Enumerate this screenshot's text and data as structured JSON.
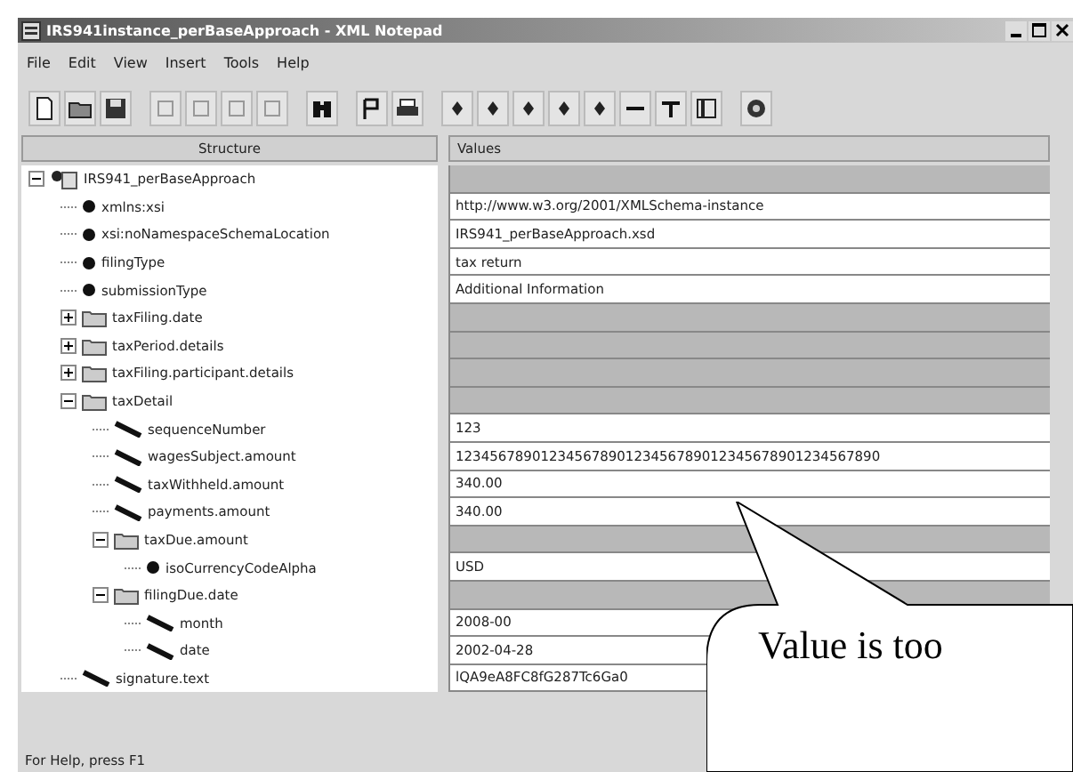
{
  "window": {
    "title": "IRS941instance_perBaseApproach - XML Notepad"
  },
  "menu": [
    "File",
    "Edit",
    "View",
    "Insert",
    "Tools",
    "Help"
  ],
  "columns": [
    "Structure",
    "Values"
  ],
  "tree": [
    {
      "kind": "root",
      "name": "IRS941_perBaseApproach",
      "expanded": true,
      "children": [
        {
          "kind": "attribute",
          "name": "xmlns:xsi",
          "value": "http://www.w3.org/2001/XMLSchema-instance"
        },
        {
          "kind": "attribute",
          "name": "xsi:noNamespaceSchemaLocation",
          "value": "IRS941_perBaseApproach.xsd"
        },
        {
          "kind": "attribute",
          "name": "filingType",
          "value": "tax return"
        },
        {
          "kind": "attribute",
          "name": "submissionType",
          "value": "Additional Information"
        },
        {
          "kind": "folder",
          "name": "taxFiling.date",
          "expanded": false
        },
        {
          "kind": "folder",
          "name": "taxPeriod.details",
          "expanded": false
        },
        {
          "kind": "folder",
          "name": "taxFiling.participant.details",
          "expanded": false
        },
        {
          "kind": "folder",
          "name": "taxDetail",
          "expanded": true,
          "children": [
            {
              "kind": "leaf",
              "name": "sequenceNumber",
              "value": "123"
            },
            {
              "kind": "leaf",
              "name": "wagesSubject.amount",
              "value": "12345678901234567890123456789012345678901234567890"
            },
            {
              "kind": "leaf",
              "name": "taxWithheld.amount",
              "value": "340.00"
            },
            {
              "kind": "leaf",
              "name": "payments.amount",
              "value": "340.00"
            },
            {
              "kind": "folder",
              "name": "taxDue.amount",
              "expanded": true,
              "children": [
                {
                  "kind": "attribute",
                  "name": "isoCurrencyCodeAlpha",
                  "value": "USD"
                }
              ]
            },
            {
              "kind": "folder",
              "name": "filingDue.date",
              "expanded": true,
              "children": [
                {
                  "kind": "leaf",
                  "name": "month",
                  "value": "2008-00"
                },
                {
                  "kind": "leaf",
                  "name": "date",
                  "value": "2002-04-28"
                }
              ]
            }
          ]
        },
        {
          "kind": "leaf",
          "name": "signature.text",
          "value": "lQA9eA8FC8fG287Tc6Ga0"
        }
      ]
    }
  ],
  "status_bar": "For Help, press F1",
  "callout": "Value is too"
}
